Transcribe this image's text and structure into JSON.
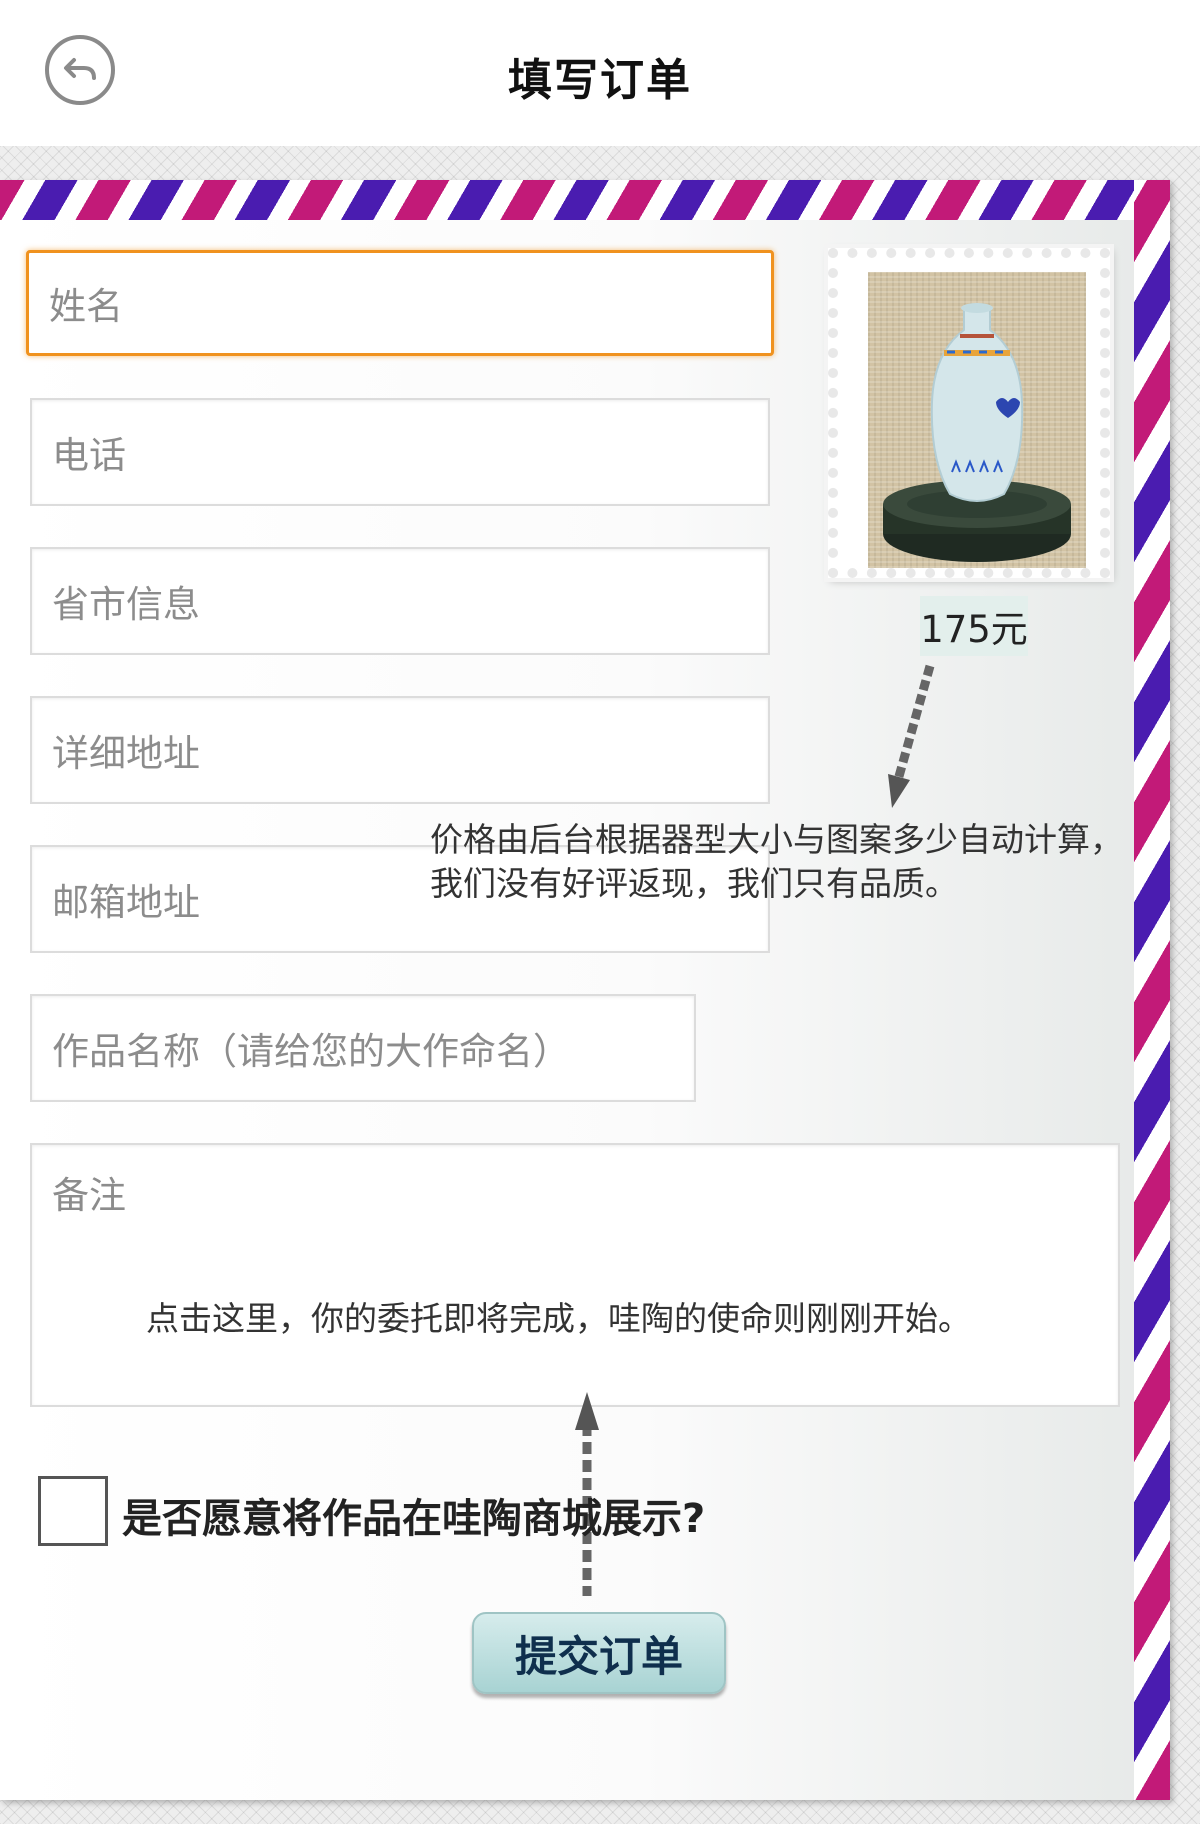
{
  "header": {
    "title": "填写订单",
    "back_icon": "back-arrow-icon"
  },
  "form": {
    "name_placeholder": "姓名",
    "phone_placeholder": "电话",
    "region_placeholder": "省市信息",
    "address_placeholder": "详细地址",
    "email_placeholder": "邮箱地址",
    "artwork_name_placeholder": "作品名称（请给您的大作命名）",
    "remarks_placeholder": "备注"
  },
  "product": {
    "price": "175元",
    "image": "vase-on-stand"
  },
  "annotations": {
    "price_note": "价格由后台根据器型大小与图案多少自动计算，我们没有好评返现，我们只有品质。",
    "submit_hint": "点击这里，你的委托即将完成，哇陶的使命则刚刚开始。"
  },
  "showcase": {
    "label": "是否愿意将作品在哇陶商城展示?",
    "checked": false
  },
  "submit": {
    "label": "提交订单"
  },
  "colors": {
    "focus_border": "#f0921e",
    "stripe_magenta": "#c21a78",
    "stripe_purple": "#4a1cb0",
    "button_bg": "#a8d3d3",
    "button_text": "#0f2f4d"
  }
}
